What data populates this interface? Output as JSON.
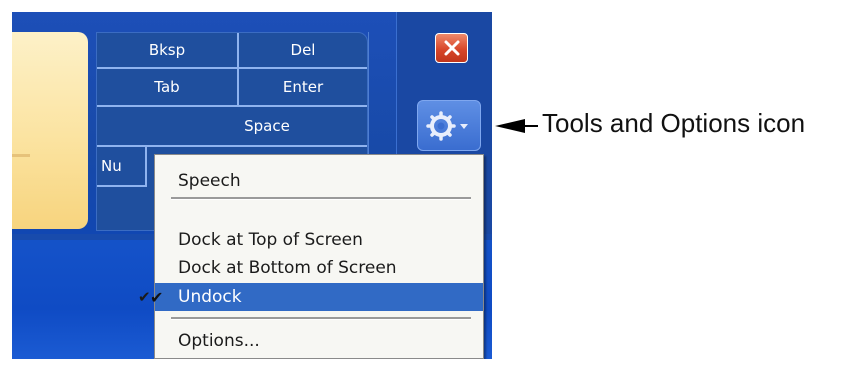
{
  "keyboard": {
    "keys": [
      {
        "label": "Bksp"
      },
      {
        "label": "Del"
      },
      {
        "label": "Tab"
      },
      {
        "label": "Enter"
      },
      {
        "label": "Space"
      },
      {
        "label": "Nu"
      }
    ]
  },
  "window_controls": {
    "close_icon": "close-x-icon",
    "tools_icon": "gear-icon",
    "tools_dropdown": "chevron-down-icon"
  },
  "menu": {
    "items": [
      {
        "label": "Speech"
      },
      {
        "label": "Dock at Top of Screen"
      },
      {
        "label": "Dock at Bottom of Screen"
      },
      {
        "label": "Undock",
        "checked": true,
        "selected": true
      },
      {
        "label": "Options..."
      }
    ]
  },
  "annotation": {
    "label": "Tools and Options icon"
  },
  "colors": {
    "accent": "#316ac5",
    "close": "#d8472a",
    "panel": "#1f4f9e"
  }
}
